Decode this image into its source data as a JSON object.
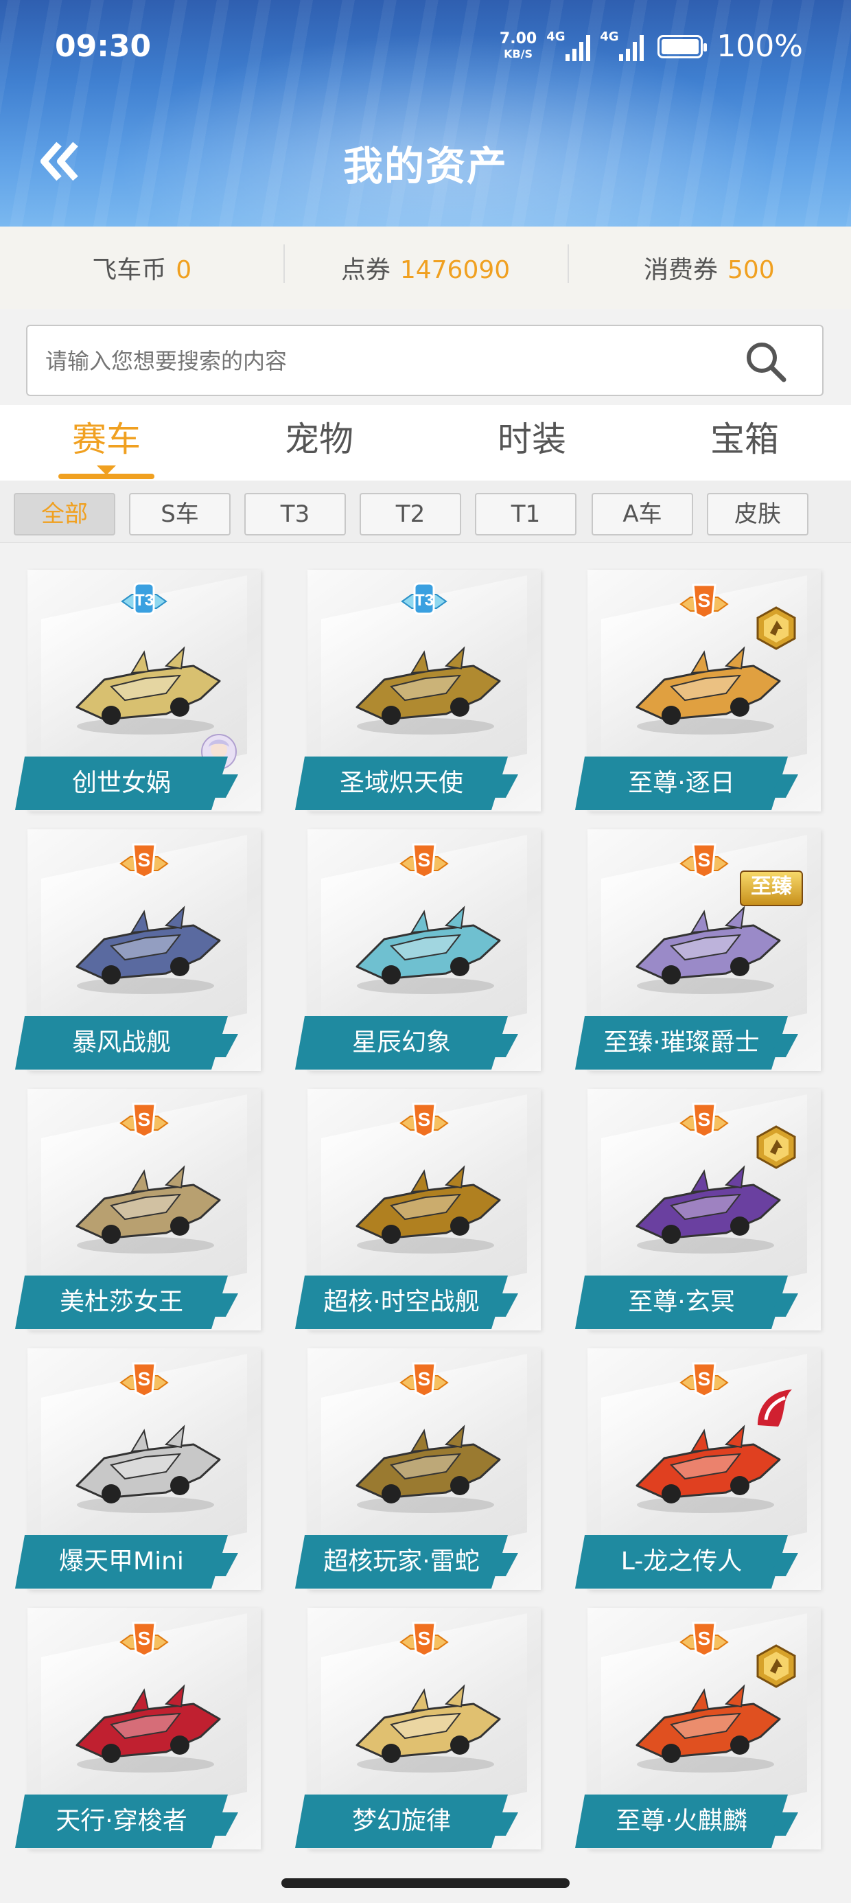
{
  "status_bar": {
    "time": "09:30",
    "net_speed": "7.00",
    "net_unit": "KB/S",
    "sig1_label": "4G",
    "sig2_label": "4G",
    "battery_text": "100%"
  },
  "header": {
    "title": "我的资产",
    "back_icon": "double-chevron-left-icon"
  },
  "currency": [
    {
      "label": "飞车币",
      "value": "0"
    },
    {
      "label": "点券",
      "value": "1476090"
    },
    {
      "label": "消费券",
      "value": "500"
    }
  ],
  "search": {
    "placeholder": "请输入您想要搜索的内容",
    "icon": "search-icon"
  },
  "tabs": [
    {
      "label": "赛车",
      "active": true
    },
    {
      "label": "宠物",
      "active": false
    },
    {
      "label": "时装",
      "active": false
    },
    {
      "label": "宝箱",
      "active": false
    }
  ],
  "filters": [
    {
      "label": "全部",
      "active": true
    },
    {
      "label": "S车",
      "active": false
    },
    {
      "label": "T3",
      "active": false
    },
    {
      "label": "T2",
      "active": false
    },
    {
      "label": "T1",
      "active": false
    },
    {
      "label": "A车",
      "active": false
    },
    {
      "label": "皮肤",
      "active": false
    }
  ],
  "colors": {
    "accent": "#f0a020",
    "label_teal": "#1f8aa0",
    "header_blue": "#3f7fd0"
  },
  "items": [
    {
      "name": "创世女娲",
      "badge": "T3",
      "extra": "avatar-icon",
      "hue": "#d8c070"
    },
    {
      "name": "圣域炽天使",
      "badge": "T3",
      "extra": "",
      "hue": "#b08a30"
    },
    {
      "name": "至尊·逐日",
      "badge": "S",
      "extra": "supreme-icon",
      "hue": "#e0a040"
    },
    {
      "name": "暴风战舰",
      "badge": "S",
      "extra": "",
      "hue": "#5a6aa0"
    },
    {
      "name": "星辰幻象",
      "badge": "S",
      "extra": "",
      "hue": "#6fc0d0"
    },
    {
      "name": "至臻·璀璨爵士",
      "badge": "S",
      "extra": "至臻",
      "hue": "#9a8ac8"
    },
    {
      "name": "美杜莎女王",
      "badge": "S",
      "extra": "",
      "hue": "#b8a070"
    },
    {
      "name": "超核·时空战舰",
      "badge": "S",
      "extra": "",
      "hue": "#b08020"
    },
    {
      "name": "至尊·玄冥",
      "badge": "S",
      "extra": "supreme-icon",
      "hue": "#6a40a0"
    },
    {
      "name": "爆天甲Mini",
      "badge": "S",
      "extra": "",
      "hue": "#c8c8c8"
    },
    {
      "name": "超核玩家·雷蛇",
      "badge": "S",
      "extra": "",
      "hue": "#9a7a30"
    },
    {
      "name": "L-龙之传人",
      "badge": "S",
      "extra": "dragon-heir-icon",
      "hue": "#e04020"
    },
    {
      "name": "天行·穿梭者",
      "badge": "S",
      "extra": "",
      "hue": "#c02030"
    },
    {
      "name": "梦幻旋律",
      "badge": "S",
      "extra": "",
      "hue": "#e0c070"
    },
    {
      "name": "至尊·火麒麟",
      "badge": "S",
      "extra": "supreme-icon",
      "hue": "#e05020"
    }
  ]
}
